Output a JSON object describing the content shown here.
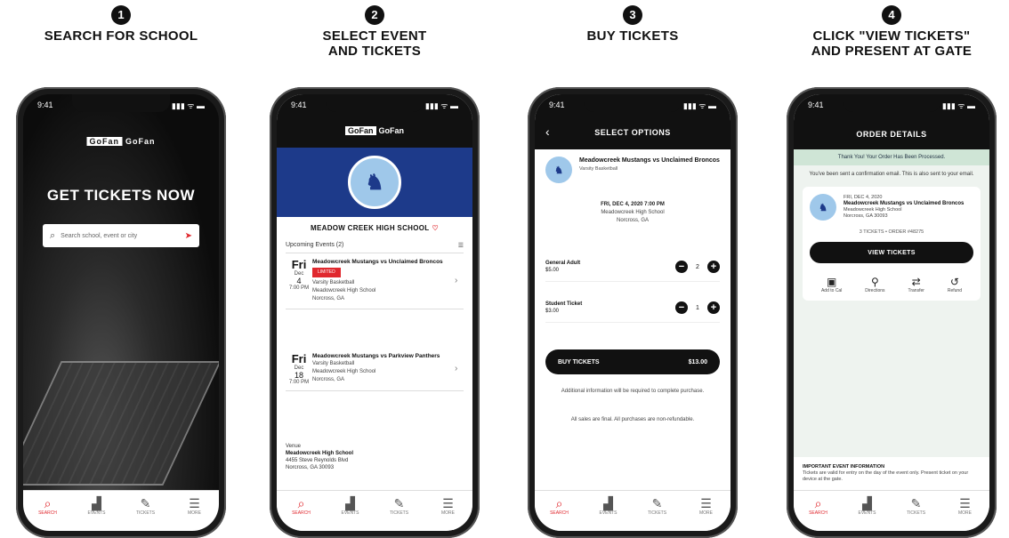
{
  "steps": [
    {
      "number": "1",
      "title": "SEARCH FOR SCHOOL"
    },
    {
      "number": "2",
      "title": "SELECT EVENT AND TICKETS"
    },
    {
      "number": "3",
      "title": "BUY TICKETS"
    },
    {
      "number": "4",
      "title": "CLICK \"VIEW TICKETS\" AND PRESENT AT GATE"
    }
  ],
  "status": {
    "time": "9:41",
    "signal": "▮▮▮ ᯤ ▬"
  },
  "tabbar": [
    {
      "label": "SEARCH",
      "icon": "search-icon",
      "glyph": "⌕"
    },
    {
      "label": "EVENTS",
      "icon": "stadium-icon",
      "glyph": "▟"
    },
    {
      "label": "TICKETS",
      "icon": "ticket-icon",
      "glyph": "✎"
    },
    {
      "label": "MORE",
      "icon": "menu-icon",
      "glyph": "☰"
    }
  ],
  "phone1": {
    "brand_badge": "GoFan",
    "brand_text": "GoFan",
    "headline": "GET TICKETS NOW",
    "search_placeholder": "Search school, event or city"
  },
  "phone2": {
    "brand_badge": "GoFan",
    "brand_text": "GoFan",
    "school_name": "MEADOW CREEK HIGH SCHOOL",
    "upcoming_label": "Upcoming Events (2)",
    "events": [
      {
        "dow": "Fri",
        "mon": "Dec",
        "day": "4",
        "time": "7:00 PM",
        "title": "Meadowcreek Mustangs vs Unclaimed Broncos",
        "tag": "LIMITED",
        "line1": "Varsity Basketball",
        "line2": "Meadowcreek High School",
        "line3": "Norcross, GA"
      },
      {
        "dow": "Fri",
        "mon": "Dec",
        "day": "18",
        "time": "7:00 PM",
        "title": "Meadowcreek Mustangs vs Parkview Panthers",
        "tag": "",
        "line1": "Varsity Basketball",
        "line2": "Meadowcreek High School",
        "line3": "Norcross, GA"
      }
    ],
    "footer_label": "Venue",
    "footer_title": "Meadowcreek High School",
    "footer_addr1": "4455 Steve Reynolds Blvd",
    "footer_addr2": "Norcross, GA 30093"
  },
  "phone3": {
    "title": "SELECT OPTIONS",
    "event_title": "Meadowcreek Mustangs vs Unclaimed Broncos",
    "event_sub": "Varsity Basketball",
    "dt1": "FRI, DEC 4, 2020 7:00 PM",
    "dt2": "Meadowcreek High School",
    "dt3": "Norcross, GA",
    "tickets": [
      {
        "name": "General Adult",
        "price": "$5.00",
        "qty": "2"
      },
      {
        "name": "Student Ticket",
        "price": "$3.00",
        "qty": "1"
      }
    ],
    "buy_label": "BUY TICKETS",
    "buy_total": "$13.00",
    "note1": "Additional information will be required to complete purchase.",
    "note2": "All sales are final. All purchases are non-refundable."
  },
  "phone4": {
    "title": "ORDER DETAILS",
    "thanks": "Thank You! Your Order Has Been Processed.",
    "confirm": "You've been sent a confirmation email. This is also sent to your email.",
    "event_title": "Meadowcreek Mustangs vs Unclaimed Broncos",
    "event_date": "FRI, DEC 4, 2020",
    "event_venue": "Meadowcreek High School",
    "event_city": "Norcross, GA 30093",
    "ticket_count": "3 TICKETS • ORDER #48275",
    "view_label": "VIEW TICKETS",
    "actions": [
      {
        "label": "Add to Cal",
        "icon": "calendar-icon",
        "glyph": "▣"
      },
      {
        "label": "Directions",
        "icon": "location-icon",
        "glyph": "⚲"
      },
      {
        "label": "Transfer",
        "icon": "transfer-icon",
        "glyph": "⇄"
      },
      {
        "label": "Refund",
        "icon": "refund-icon",
        "glyph": "↺"
      }
    ],
    "info_title": "IMPORTANT EVENT INFORMATION",
    "info_text": "Tickets are valid for entry on the day of the event only. Present ticket on your device at the gate."
  }
}
